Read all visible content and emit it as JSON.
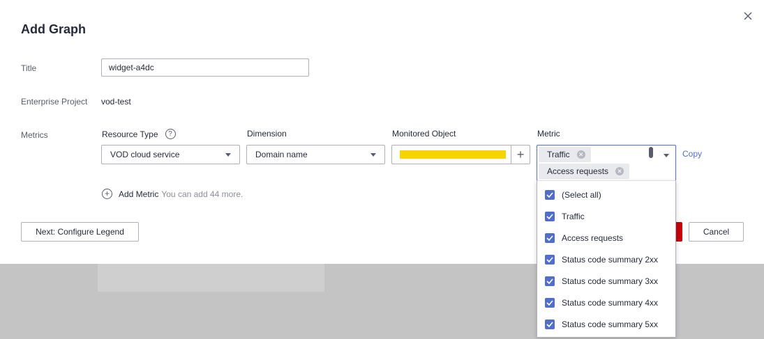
{
  "dialog": {
    "title": "Add Graph",
    "close_icon": "close-icon"
  },
  "form": {
    "title_label": "Title",
    "title_value": "widget-a4dc",
    "project_label": "Enterprise Project",
    "project_value": "vod-test",
    "metrics_label": "Metrics"
  },
  "columns": {
    "resource_type": "Resource Type",
    "dimension": "Dimension",
    "monitored_object": "Monitored Object",
    "metric": "Metric"
  },
  "selects": {
    "resource_type_value": "VOD cloud service",
    "dimension_value": "Domain name"
  },
  "metric_tags": [
    "Traffic",
    "Access requests"
  ],
  "copy_label": "Copy",
  "add_metric": {
    "label": "Add Metric",
    "hint": "You can add 44 more."
  },
  "buttons": {
    "next": "Next: Configure Legend",
    "cancel": "Cancel"
  },
  "dropdown_options": [
    {
      "label": "(Select all)",
      "checked": true
    },
    {
      "label": "Traffic",
      "checked": true
    },
    {
      "label": "Access requests",
      "checked": true
    },
    {
      "label": "Status code summary 2xx",
      "checked": true
    },
    {
      "label": "Status code summary 3xx",
      "checked": true
    },
    {
      "label": "Status code summary 4xx",
      "checked": true
    },
    {
      "label": "Status code summary 5xx",
      "checked": true
    }
  ],
  "colors": {
    "accent": "#526ecc",
    "primary": "#c7000b",
    "redaction": "#f5d400"
  }
}
